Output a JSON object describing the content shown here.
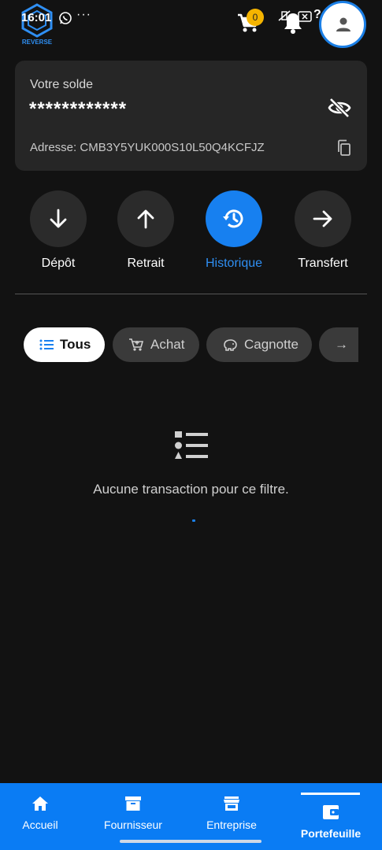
{
  "status_bar": {
    "time": "16:01",
    "dots": "···",
    "cart_count": "0",
    "network_label": "?"
  },
  "logo": {
    "text": "REVERSE"
  },
  "balance": {
    "label": "Votre solde",
    "value": "************",
    "address": "Adresse: CMB3Y5YUK000S10L50Q4KCFJZ"
  },
  "actions": [
    {
      "label": "Dépôt",
      "icon": "arrow-down-icon",
      "active": false
    },
    {
      "label": "Retrait",
      "icon": "arrow-up-icon",
      "active": false
    },
    {
      "label": "Historique",
      "icon": "history-icon",
      "active": true
    },
    {
      "label": "Transfert",
      "icon": "arrow-right-icon",
      "active": false
    }
  ],
  "filters": [
    {
      "label": "Tous",
      "icon": "list-icon",
      "active": true
    },
    {
      "label": "Achat",
      "icon": "cart-icon",
      "active": false
    },
    {
      "label": "Cagnotte",
      "icon": "piggy-bank-icon",
      "active": false
    },
    {
      "label": "→",
      "icon": "arrow-right-icon",
      "active": false
    }
  ],
  "empty_state": {
    "message": "Aucune transaction pour ce filtre."
  },
  "bottom_nav": [
    {
      "label": "Accueil",
      "icon": "home-icon",
      "active": false
    },
    {
      "label": "Fournisseur",
      "icon": "archive-box-icon",
      "active": false
    },
    {
      "label": "Entreprise",
      "icon": "storefront-icon",
      "active": false
    },
    {
      "label": "Portefeuille",
      "icon": "wallet-icon",
      "active": true
    }
  ],
  "colors": {
    "background": "#121212",
    "card": "#262626",
    "accent": "#1780f0",
    "badge": "#f5b400",
    "nav": "#0a7cf4"
  }
}
